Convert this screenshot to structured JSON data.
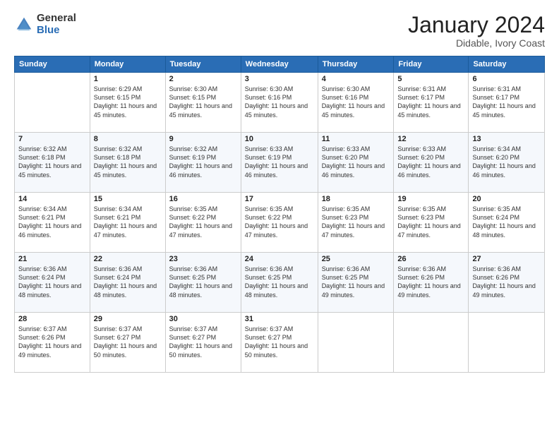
{
  "logo": {
    "general": "General",
    "blue": "Blue"
  },
  "title": {
    "month": "January 2024",
    "location": "Didable, Ivory Coast"
  },
  "calendar": {
    "headers": [
      "Sunday",
      "Monday",
      "Tuesday",
      "Wednesday",
      "Thursday",
      "Friday",
      "Saturday"
    ],
    "weeks": [
      [
        {
          "day": "",
          "sunrise": "",
          "sunset": "",
          "daylight": ""
        },
        {
          "day": "1",
          "sunrise": "Sunrise: 6:29 AM",
          "sunset": "Sunset: 6:15 PM",
          "daylight": "Daylight: 11 hours and 45 minutes."
        },
        {
          "day": "2",
          "sunrise": "Sunrise: 6:30 AM",
          "sunset": "Sunset: 6:15 PM",
          "daylight": "Daylight: 11 hours and 45 minutes."
        },
        {
          "day": "3",
          "sunrise": "Sunrise: 6:30 AM",
          "sunset": "Sunset: 6:16 PM",
          "daylight": "Daylight: 11 hours and 45 minutes."
        },
        {
          "day": "4",
          "sunrise": "Sunrise: 6:30 AM",
          "sunset": "Sunset: 6:16 PM",
          "daylight": "Daylight: 11 hours and 45 minutes."
        },
        {
          "day": "5",
          "sunrise": "Sunrise: 6:31 AM",
          "sunset": "Sunset: 6:17 PM",
          "daylight": "Daylight: 11 hours and 45 minutes."
        },
        {
          "day": "6",
          "sunrise": "Sunrise: 6:31 AM",
          "sunset": "Sunset: 6:17 PM",
          "daylight": "Daylight: 11 hours and 45 minutes."
        }
      ],
      [
        {
          "day": "7",
          "sunrise": "Sunrise: 6:32 AM",
          "sunset": "Sunset: 6:18 PM",
          "daylight": "Daylight: 11 hours and 45 minutes."
        },
        {
          "day": "8",
          "sunrise": "Sunrise: 6:32 AM",
          "sunset": "Sunset: 6:18 PM",
          "daylight": "Daylight: 11 hours and 45 minutes."
        },
        {
          "day": "9",
          "sunrise": "Sunrise: 6:32 AM",
          "sunset": "Sunset: 6:19 PM",
          "daylight": "Daylight: 11 hours and 46 minutes."
        },
        {
          "day": "10",
          "sunrise": "Sunrise: 6:33 AM",
          "sunset": "Sunset: 6:19 PM",
          "daylight": "Daylight: 11 hours and 46 minutes."
        },
        {
          "day": "11",
          "sunrise": "Sunrise: 6:33 AM",
          "sunset": "Sunset: 6:20 PM",
          "daylight": "Daylight: 11 hours and 46 minutes."
        },
        {
          "day": "12",
          "sunrise": "Sunrise: 6:33 AM",
          "sunset": "Sunset: 6:20 PM",
          "daylight": "Daylight: 11 hours and 46 minutes."
        },
        {
          "day": "13",
          "sunrise": "Sunrise: 6:34 AM",
          "sunset": "Sunset: 6:20 PM",
          "daylight": "Daylight: 11 hours and 46 minutes."
        }
      ],
      [
        {
          "day": "14",
          "sunrise": "Sunrise: 6:34 AM",
          "sunset": "Sunset: 6:21 PM",
          "daylight": "Daylight: 11 hours and 46 minutes."
        },
        {
          "day": "15",
          "sunrise": "Sunrise: 6:34 AM",
          "sunset": "Sunset: 6:21 PM",
          "daylight": "Daylight: 11 hours and 47 minutes."
        },
        {
          "day": "16",
          "sunrise": "Sunrise: 6:35 AM",
          "sunset": "Sunset: 6:22 PM",
          "daylight": "Daylight: 11 hours and 47 minutes."
        },
        {
          "day": "17",
          "sunrise": "Sunrise: 6:35 AM",
          "sunset": "Sunset: 6:22 PM",
          "daylight": "Daylight: 11 hours and 47 minutes."
        },
        {
          "day": "18",
          "sunrise": "Sunrise: 6:35 AM",
          "sunset": "Sunset: 6:23 PM",
          "daylight": "Daylight: 11 hours and 47 minutes."
        },
        {
          "day": "19",
          "sunrise": "Sunrise: 6:35 AM",
          "sunset": "Sunset: 6:23 PM",
          "daylight": "Daylight: 11 hours and 47 minutes."
        },
        {
          "day": "20",
          "sunrise": "Sunrise: 6:35 AM",
          "sunset": "Sunset: 6:24 PM",
          "daylight": "Daylight: 11 hours and 48 minutes."
        }
      ],
      [
        {
          "day": "21",
          "sunrise": "Sunrise: 6:36 AM",
          "sunset": "Sunset: 6:24 PM",
          "daylight": "Daylight: 11 hours and 48 minutes."
        },
        {
          "day": "22",
          "sunrise": "Sunrise: 6:36 AM",
          "sunset": "Sunset: 6:24 PM",
          "daylight": "Daylight: 11 hours and 48 minutes."
        },
        {
          "day": "23",
          "sunrise": "Sunrise: 6:36 AM",
          "sunset": "Sunset: 6:25 PM",
          "daylight": "Daylight: 11 hours and 48 minutes."
        },
        {
          "day": "24",
          "sunrise": "Sunrise: 6:36 AM",
          "sunset": "Sunset: 6:25 PM",
          "daylight": "Daylight: 11 hours and 48 minutes."
        },
        {
          "day": "25",
          "sunrise": "Sunrise: 6:36 AM",
          "sunset": "Sunset: 6:25 PM",
          "daylight": "Daylight: 11 hours and 49 minutes."
        },
        {
          "day": "26",
          "sunrise": "Sunrise: 6:36 AM",
          "sunset": "Sunset: 6:26 PM",
          "daylight": "Daylight: 11 hours and 49 minutes."
        },
        {
          "day": "27",
          "sunrise": "Sunrise: 6:36 AM",
          "sunset": "Sunset: 6:26 PM",
          "daylight": "Daylight: 11 hours and 49 minutes."
        }
      ],
      [
        {
          "day": "28",
          "sunrise": "Sunrise: 6:37 AM",
          "sunset": "Sunset: 6:26 PM",
          "daylight": "Daylight: 11 hours and 49 minutes."
        },
        {
          "day": "29",
          "sunrise": "Sunrise: 6:37 AM",
          "sunset": "Sunset: 6:27 PM",
          "daylight": "Daylight: 11 hours and 50 minutes."
        },
        {
          "day": "30",
          "sunrise": "Sunrise: 6:37 AM",
          "sunset": "Sunset: 6:27 PM",
          "daylight": "Daylight: 11 hours and 50 minutes."
        },
        {
          "day": "31",
          "sunrise": "Sunrise: 6:37 AM",
          "sunset": "Sunset: 6:27 PM",
          "daylight": "Daylight: 11 hours and 50 minutes."
        },
        {
          "day": "",
          "sunrise": "",
          "sunset": "",
          "daylight": ""
        },
        {
          "day": "",
          "sunrise": "",
          "sunset": "",
          "daylight": ""
        },
        {
          "day": "",
          "sunrise": "",
          "sunset": "",
          "daylight": ""
        }
      ]
    ]
  }
}
